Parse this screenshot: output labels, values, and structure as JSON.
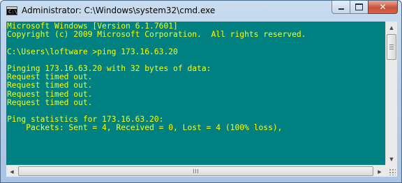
{
  "window": {
    "title": "Administrator: C:\\Windows\\system32\\cmd.exe",
    "icon_text": "C:\\",
    "minimize_label": "Minimize",
    "maximize_label": "Maximize",
    "close_label": "Close"
  },
  "console": {
    "background_color": "#008080",
    "text_color": "#ffff00",
    "lines": [
      "Microsoft Windows [Version 6.1.7601]",
      "Copyright (c) 2009 Microsoft Corporation.  All rights reserved.",
      "",
      "C:\\Users\\loftware >ping 173.16.63.20",
      "",
      "Pinging 173.16.63.20 with 32 bytes of data:",
      "Request timed out.",
      "Request timed out.",
      "Request timed out.",
      "Request timed out.",
      "",
      "Ping statistics for 173.16.63.20:",
      "    Packets: Sent = 4, Received = 0, Lost = 4 (100% loss),"
    ]
  },
  "scrollbars": {
    "up_arrow": "▲",
    "down_arrow": "▼",
    "left_arrow": "◀",
    "right_arrow": "▶"
  }
}
